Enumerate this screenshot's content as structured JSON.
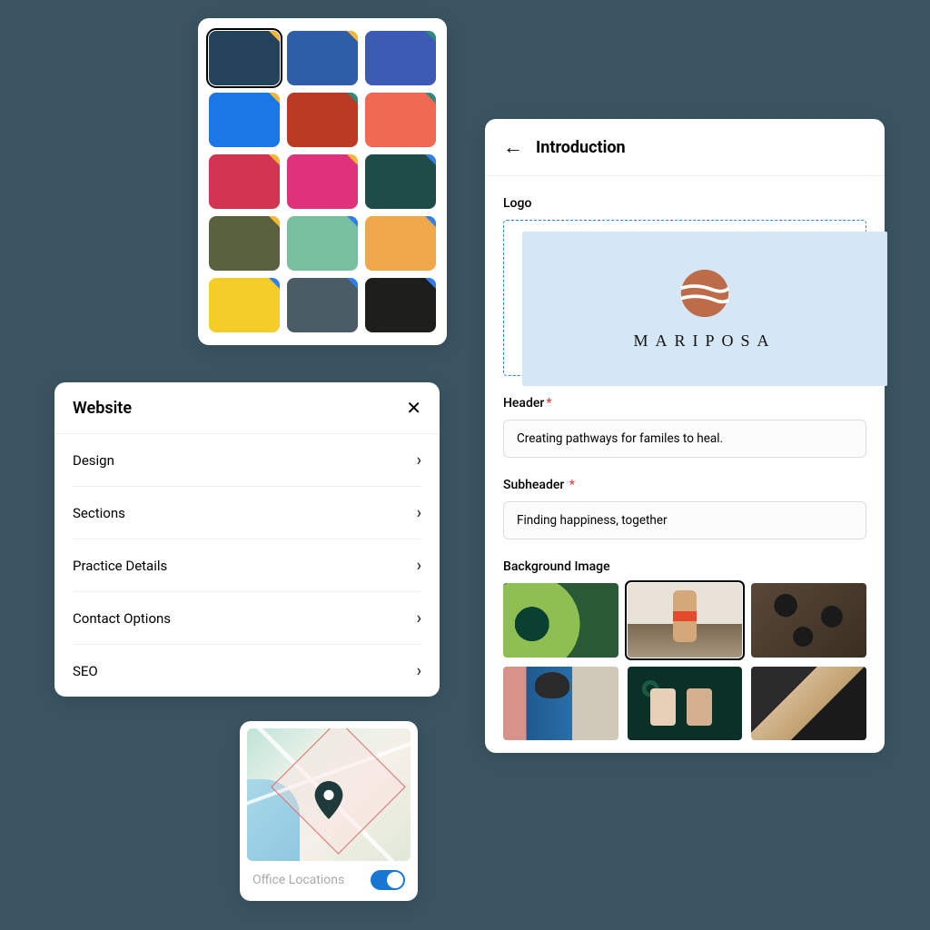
{
  "palette": {
    "swatches": [
      {
        "color": "#24425c",
        "selected": true,
        "tag": "yellow"
      },
      {
        "color": "#2f5ea8",
        "selected": false,
        "tag": "yellow"
      },
      {
        "color": "#3c5bb5",
        "selected": false,
        "tag": "teal"
      },
      {
        "color": "#1a77e6",
        "selected": false,
        "tag": "yellow"
      },
      {
        "color": "#ba3a24",
        "selected": false,
        "tag": "teal"
      },
      {
        "color": "#f06a52",
        "selected": false,
        "tag": "teal"
      },
      {
        "color": "#d13552",
        "selected": false,
        "tag": "yellow"
      },
      {
        "color": "#e0327a",
        "selected": false,
        "tag": "yellow"
      },
      {
        "color": "#1f4c48",
        "selected": false,
        "tag": "blue"
      },
      {
        "color": "#5a613e",
        "selected": false,
        "tag": "yellow"
      },
      {
        "color": "#78bfa0",
        "selected": false,
        "tag": "blue"
      },
      {
        "color": "#f0a94a",
        "selected": false,
        "tag": "blue"
      },
      {
        "color": "#f4cd28",
        "selected": false,
        "tag": "blue"
      },
      {
        "color": "#4a5d66",
        "selected": false,
        "tag": "blue"
      },
      {
        "color": "#1e1e1c",
        "selected": false,
        "tag": "blue"
      }
    ]
  },
  "website": {
    "title": "Website",
    "items": [
      {
        "label": "Design"
      },
      {
        "label": "Sections"
      },
      {
        "label": "Practice Details"
      },
      {
        "label": "Contact Options"
      },
      {
        "label": "SEO"
      }
    ]
  },
  "map": {
    "label": "Office Locations",
    "toggle_on": true
  },
  "intro": {
    "title": "Introduction",
    "logo_label": "Logo",
    "brand_name": "MARIPOSA",
    "header_label": "Header",
    "header_value": "Creating pathways for familes to heal.",
    "subheader_label": "Subheader",
    "subheader_value": "Finding happiness, together",
    "bg_label": "Background Image",
    "bg_images": [
      {
        "name": "plant",
        "selected": false
      },
      {
        "name": "child",
        "selected": true
      },
      {
        "name": "coffee",
        "selected": false
      },
      {
        "name": "woman",
        "selected": false
      },
      {
        "name": "tubes",
        "selected": false
      },
      {
        "name": "hands",
        "selected": false
      }
    ]
  }
}
